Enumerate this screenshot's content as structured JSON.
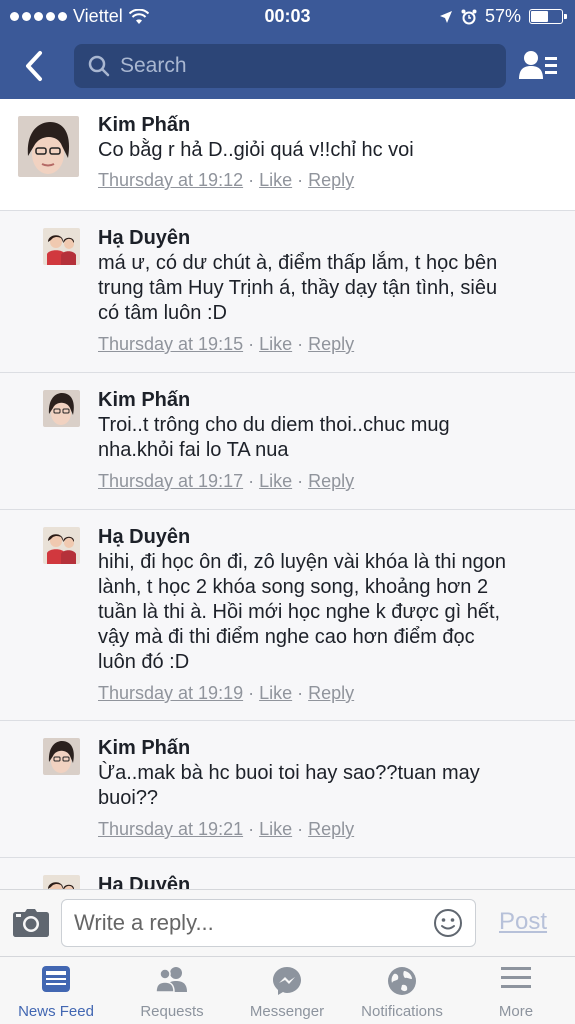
{
  "status": {
    "carrier": "Viettel",
    "time": "00:03",
    "battery": "57%",
    "battery_level": 0.57
  },
  "nav": {
    "search_placeholder": "Search"
  },
  "comments": [
    {
      "author": "Kim Phấn",
      "lines": [
        "Co bằg r hả D..giỏi quá v!!chỉ hc voi"
      ],
      "time": "Thursday at 19:12",
      "like": "Like",
      "reply": "Reply"
    },
    {
      "author": "Hạ Duyên",
      "lines": [
        "má ư, có dư chút à, điểm thấp lắm, t học bên",
        "trung tâm Huy Trịnh á, thầy dạy tận tình, siêu",
        "có tâm luôn :D"
      ],
      "time": "Thursday at 19:15",
      "like": "Like",
      "reply": "Reply"
    },
    {
      "author": "Kim Phấn",
      "lines": [
        "Troi..t trông cho du diem thoi..chuc mug",
        "nha.khỏi fai lo TA nua"
      ],
      "time": "Thursday at 19:17",
      "like": "Like",
      "reply": "Reply"
    },
    {
      "author": "Hạ Duyên",
      "lines": [
        "hihi, đi học ôn đi, zô luyện vài khóa là thi ngon",
        "lành, t học 2 khóa song song, khoảng hơn 2",
        "tuần là thi à. Hồi mới học nghe k được gì hết,",
        "vậy mà đi thi điểm nghe cao hơn điểm đọc",
        "luôn đó :D"
      ],
      "time": "Thursday at 19:19",
      "like": "Like",
      "reply": "Reply"
    },
    {
      "author": "Kim Phấn",
      "lines": [
        "Ừa..mak bà hc buoi toi hay sao??tuan may",
        "buoi??"
      ],
      "time": "Thursday at 19:21",
      "like": "Like",
      "reply": "Reply"
    },
    {
      "author": "Hạ Duyên",
      "lines": [],
      "time": "",
      "like": "",
      "reply": ""
    }
  ],
  "reply_bar": {
    "placeholder": "Write a reply...",
    "post_label": "Post"
  },
  "tabs": [
    {
      "label": "News Feed",
      "icon": "news-feed-icon"
    },
    {
      "label": "Requests",
      "icon": "friend-requests-icon"
    },
    {
      "label": "Messenger",
      "icon": "messenger-icon"
    },
    {
      "label": "Notifications",
      "icon": "globe-icon"
    },
    {
      "label": "More",
      "icon": "menu-icon"
    }
  ],
  "colors": {
    "brand": "#3b5998",
    "search_bg": "#2c4577",
    "active_tab": "#4267b2"
  }
}
